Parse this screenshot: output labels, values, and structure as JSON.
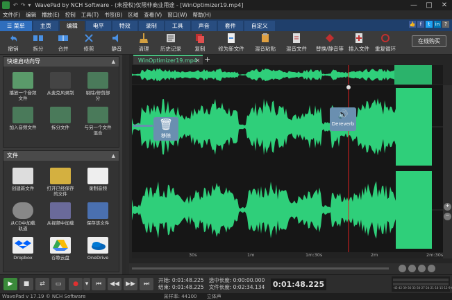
{
  "window": {
    "title": "WavePad by NCH Software - (未授权)仅限非商业用途 - [WinOptimizer19.mp4]",
    "minimize": "—",
    "maximize": "□",
    "close": "✕"
  },
  "menu": [
    "文件(F)",
    "编辑",
    "播放(E)",
    "控制",
    "工具(T)",
    "书签(B)",
    "区域",
    "查看(V)",
    "窗口(W)",
    "帮助(H)"
  ],
  "tabs": [
    {
      "label": "☰ 菜单"
    },
    {
      "label": "主页"
    },
    {
      "label": "编辑"
    },
    {
      "label": "电平"
    },
    {
      "label": "特效"
    },
    {
      "label": "录制"
    },
    {
      "label": "工具"
    },
    {
      "label": "声音"
    },
    {
      "label": "套件"
    },
    {
      "label": "自定义"
    }
  ],
  "toolbar": {
    "buttons": [
      "撤销",
      "拆分",
      "合并",
      "修剪",
      "静音",
      "清理",
      "历史记录",
      "复制",
      "修为新文件",
      "混音粘贴",
      "混音文件",
      "替换/静音等",
      "插入文件",
      "重复循环"
    ],
    "online_button": "在线购买"
  },
  "left_panel": {
    "quick_title": "快速启动向导",
    "quick_items": [
      "播放一个音频文件",
      "从麦克风录制",
      "剔除/修剪部分",
      "加入音频文件",
      "拆分文件",
      "与另一个文件混合"
    ],
    "file_title": "文件",
    "file_items": [
      "创建新文件",
      "打开已经保存的文件",
      "录制音频",
      "从CD中加载轨道",
      "从视频中加载",
      "保存该文件",
      "Dropbox",
      "谷歌云盘",
      "OneDrive"
    ]
  },
  "wave": {
    "file_tab": "WinOptimizer19.mp4",
    "delete_hint": "移除",
    "reverb_hint": "Dereverb",
    "timeline_labels": [
      "30s",
      "1m",
      "1m:30s",
      "2m",
      "2m:30s"
    ]
  },
  "transport": {
    "start_label": "开始:",
    "start_value": "0:01:48.225",
    "end_label": "结束:",
    "end_value": "0:01:48.225",
    "sel_len_label": "选中长度:",
    "sel_len_value": "0:00:00.000",
    "file_len_label": "文件长度:",
    "file_len_value": "0:02:34.134",
    "current_time": "0:01:48.225",
    "meter_labels": [
      "-45",
      "-42",
      "-39",
      "-36",
      "-33",
      "-30",
      "-27",
      "-24",
      "-21",
      "-18",
      "-15",
      "-12",
      "-9",
      "-6",
      "-3",
      "0"
    ]
  },
  "status": {
    "text": "WavePad v 17.19 © NCH Software",
    "sample_rate": "采样率: 44100",
    "channels": "立体声"
  },
  "colors": {
    "wave_green": "#2fcf7a",
    "tab_bar": "#1f3f6b",
    "playhead": "#e02020"
  }
}
